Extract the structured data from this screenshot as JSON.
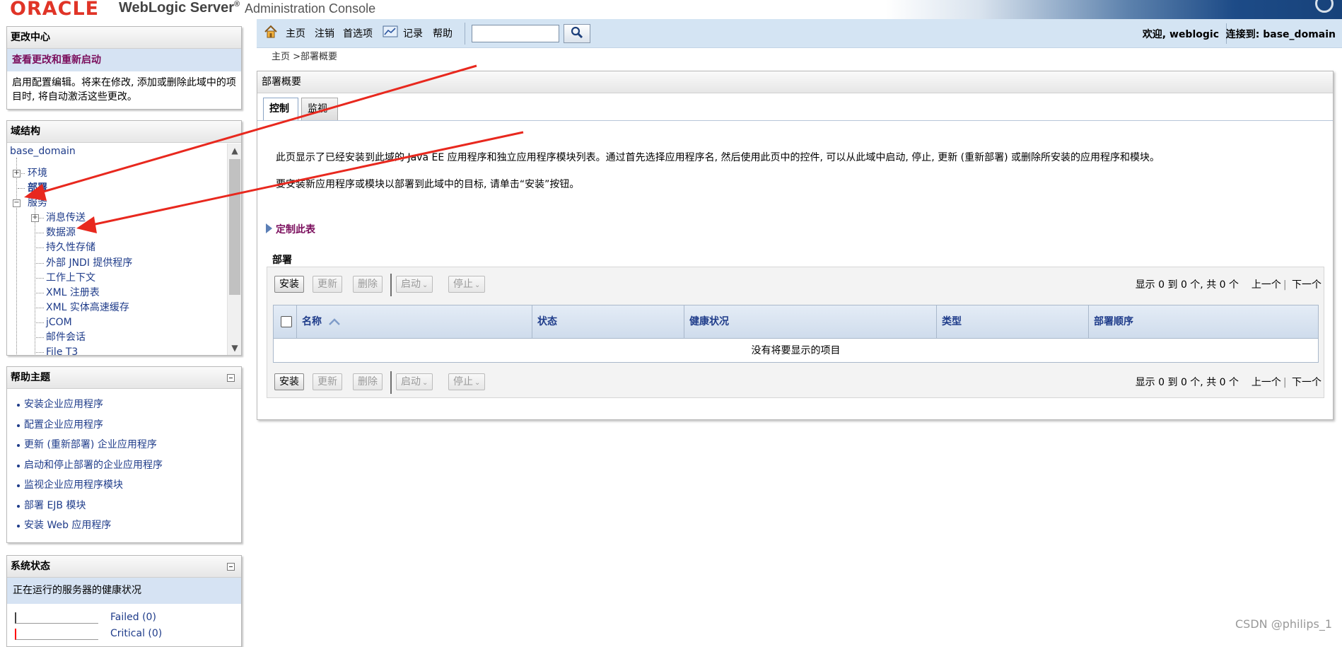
{
  "header": {
    "brand_oracle": "ORACLE",
    "brand_product": "WebLogic Server",
    "brand_reg": "®",
    "brand_console": "Administration Console"
  },
  "toolbar": {
    "home": "主页",
    "logout": "注销",
    "preferences": "首选项",
    "record": "记录",
    "help": "帮助",
    "search_value": "",
    "welcome": "欢迎, weblogic",
    "connected": "连接到: base_domain"
  },
  "breadcrumb": "主页 >部署概要",
  "change_center": {
    "title": "更改中心",
    "link": "查看更改和重新启动",
    "text": "启用配置编辑。将来在修改, 添加或删除此域中的项目时, 将自动激活这些更改。"
  },
  "domain_structure": {
    "title": "域结构",
    "items": [
      {
        "label": "base_domain"
      },
      {
        "label": "环境"
      },
      {
        "label": "部署"
      },
      {
        "label": "服务"
      },
      {
        "label": "消息传送"
      },
      {
        "label": "数据源"
      },
      {
        "label": "持久性存储"
      },
      {
        "label": "外部 JNDI 提供程序"
      },
      {
        "label": "工作上下文"
      },
      {
        "label": "XML 注册表"
      },
      {
        "label": "XML 实体高速缓存"
      },
      {
        "label": "jCOM"
      },
      {
        "label": "邮件会话"
      },
      {
        "label": "File T3"
      }
    ]
  },
  "help_topics": {
    "title": "帮助主题",
    "items": [
      "安装企业应用程序",
      "配置企业应用程序",
      "更新 (重新部署) 企业应用程序",
      "启动和停止部署的企业应用程序",
      "监视企业应用程序模块",
      "部署 EJB 模块",
      "安装 Web 应用程序"
    ]
  },
  "system_status": {
    "title": "系统状态",
    "subtitle": "正在运行的服务器的健康状况",
    "rows": [
      {
        "label": "Failed (0)",
        "color": "#c00000"
      },
      {
        "label": "Critical (0)",
        "color": "#ff0000"
      }
    ]
  },
  "content": {
    "title": "部署概要",
    "tabs": [
      "控制",
      "监视"
    ],
    "intro1": "此页显示了已经安装到此域的 Java EE 应用程序和独立应用程序模块列表。通过首先选择应用程序名, 然后使用此页中的控件, 可以从此域中启动, 停止, 更新 (重新部署) 或删除所安装的应用程序和模块。",
    "intro2": "要安装新应用程序或模块以部署到此域中的目标, 请单击“安装”按钮。",
    "customize": "定制此表",
    "section_title": "部署",
    "buttons": {
      "install": "安装",
      "update": "更新",
      "delete": "删除",
      "start": "启动",
      "stop": "停止"
    },
    "pager": {
      "summary": "显示 0 到 0 个, 共 0 个",
      "prev": "上一个",
      "sep": "|",
      "next": "下一个"
    },
    "columns": [
      "名称",
      "状态",
      "健康状况",
      "类型",
      "部署顺序"
    ],
    "empty_message": "没有将要显示的项目"
  },
  "watermark": "CSDN @philips_1",
  "colors": {
    "accent_link": "#1f3c8a",
    "highlight_link": "#7a0d5c",
    "annotation_arrow": "#e8281e",
    "toolbar_bg": "#d4e4f3"
  }
}
